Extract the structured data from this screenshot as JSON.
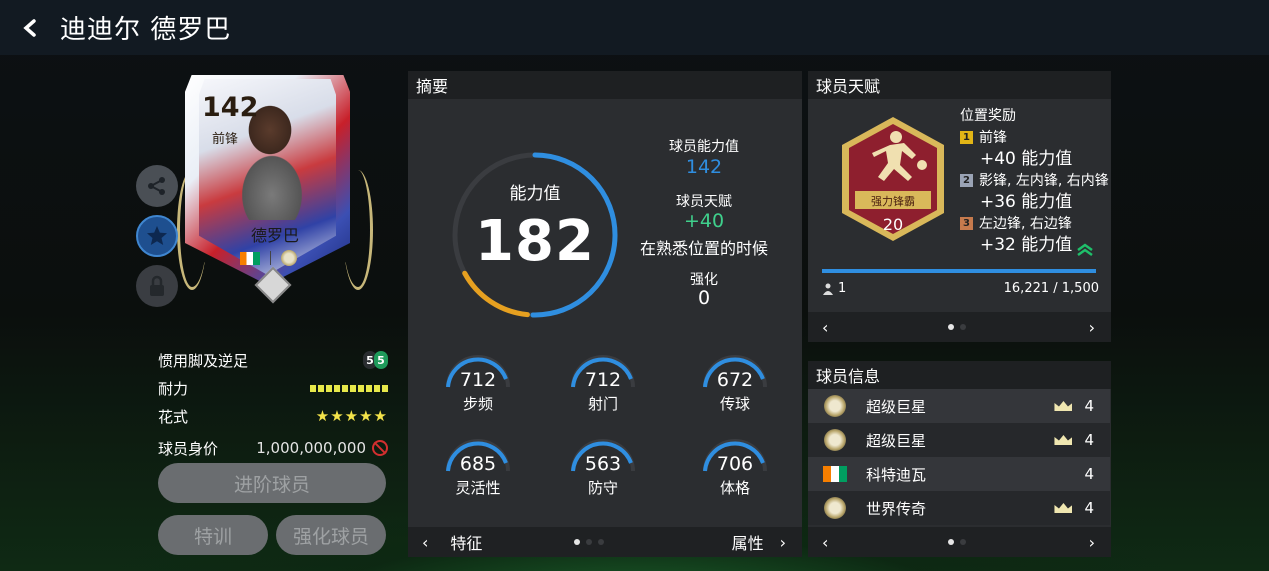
{
  "header": {
    "title": "迪迪尔 德罗巴"
  },
  "card": {
    "rating": "142",
    "position": "前锋",
    "name": "德罗巴"
  },
  "left_info": {
    "weak_foot_label": "惯用脚及逆足",
    "weak_foot_values": [
      "5",
      "5"
    ],
    "stamina_label": "耐力",
    "stamina_bars": 10,
    "skills_label": "花式",
    "skills_stars": "★★★★★",
    "value_label": "球员身价",
    "value": "1,000,000,000"
  },
  "buttons": {
    "upgrade": "进阶球员",
    "train": "特训",
    "enhance": "强化球员"
  },
  "summary": {
    "title": "摘要",
    "ovr_label": "能力值",
    "ovr_value": "182",
    "ovr_ring_fraction": 0.7,
    "base_label": "球员能力值",
    "base_value": "142",
    "talent_label": "球员天赋",
    "talent_value": "+40",
    "talent_note": "在熟悉位置的时候",
    "enhance_label": "强化",
    "enhance_value": "0",
    "stats": [
      {
        "value": "712",
        "label": "步频"
      },
      {
        "value": "712",
        "label": "射门"
      },
      {
        "value": "672",
        "label": "传球"
      },
      {
        "value": "685",
        "label": "灵活性"
      },
      {
        "value": "563",
        "label": "防守"
      },
      {
        "value": "706",
        "label": "体格"
      }
    ],
    "footer_left": "特征",
    "footer_right": "属性",
    "prev": "‹",
    "next": "›"
  },
  "talent": {
    "title": "球员天赋",
    "badge_name": "强力锋霸",
    "badge_level": "20",
    "bonus_title": "位置奖励",
    "bonuses": [
      {
        "rank": "1",
        "positions": "前锋",
        "value": "+40 能力值",
        "color": "#e2b516"
      },
      {
        "rank": "2",
        "positions": "影锋, 左内锋, 右内锋",
        "value": "+36 能力值",
        "color": "#9aa3b5"
      },
      {
        "rank": "3",
        "positions": "左边锋, 右边锋",
        "value": "+32 能力值",
        "color": "#c67a4d"
      }
    ],
    "progress_fraction": 1.0,
    "owners": "1",
    "progress_text": "16,221 / 1,500"
  },
  "player_info": {
    "title": "球员信息",
    "items": [
      {
        "label": "超级巨星",
        "rank": "4",
        "crown": true,
        "icon": "icon-medal"
      },
      {
        "label": "超级巨星",
        "rank": "4",
        "crown": true,
        "icon": "icon-medal"
      },
      {
        "label": "科特迪瓦",
        "rank": "4",
        "crown": false,
        "icon": "flag"
      },
      {
        "label": "世界传奇",
        "rank": "4",
        "crown": true,
        "icon": "icon-medal"
      }
    ]
  },
  "colors": {
    "accent_blue": "#2f8ee0",
    "accent_green": "#3fd08c",
    "ring_orange": "#e6a020",
    "bonus_green": "#1fbf6a"
  }
}
